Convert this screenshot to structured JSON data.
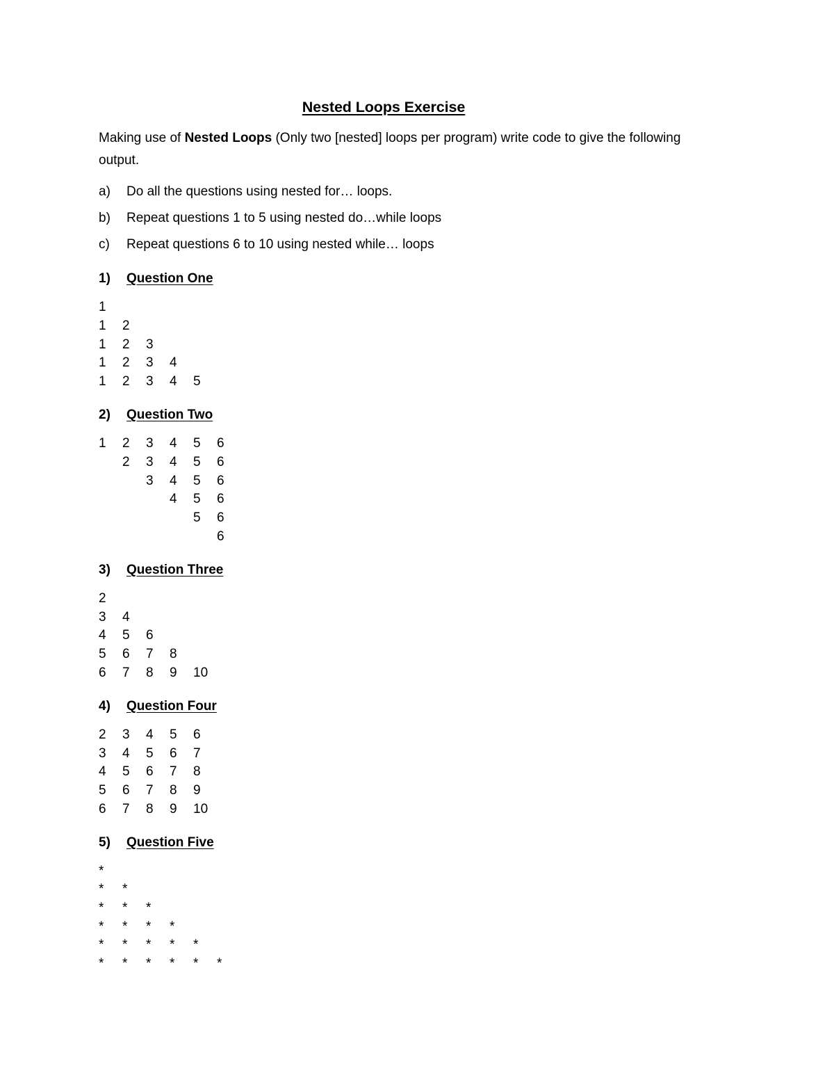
{
  "document": {
    "title": "Nested Loops Exercise",
    "intro": {
      "before_bold": "Making use of ",
      "bold": "Nested Loops",
      "after_bold": " (Only two [nested] loops per program) write code to give the following output."
    },
    "instructions": [
      {
        "marker": "a)",
        "text": "Do all the questions using nested for… loops."
      },
      {
        "marker": "b)",
        "text": "Repeat questions 1 to 5 using nested do…while loops"
      },
      {
        "marker": "c)",
        "text": "Repeat questions 6 to 10 using nested while… loops"
      }
    ],
    "questions": [
      {
        "number": "1)",
        "label": "Question One",
        "pattern_type": "numbers",
        "rows": [
          [
            "1"
          ],
          [
            "1",
            "2"
          ],
          [
            "1",
            "2",
            "3"
          ],
          [
            "1",
            "2",
            "3",
            "4"
          ],
          [
            "1",
            "2",
            "3",
            "4",
            "5"
          ]
        ]
      },
      {
        "number": "2)",
        "label": "Question Two",
        "pattern_type": "numbers",
        "rows": [
          [
            "1",
            "2",
            "3",
            "4",
            "5",
            "6"
          ],
          [
            "",
            "2",
            "3",
            "4",
            "5",
            "6"
          ],
          [
            "",
            "",
            "3",
            "4",
            "5",
            "6"
          ],
          [
            "",
            "",
            "",
            "4",
            "5",
            "6"
          ],
          [
            "",
            "",
            "",
            "",
            "5",
            "6"
          ],
          [
            "",
            "",
            "",
            "",
            "",
            "6"
          ]
        ]
      },
      {
        "number": "3)",
        "label": "Question Three",
        "pattern_type": "numbers",
        "rows": [
          [
            "2"
          ],
          [
            "3",
            "4"
          ],
          [
            "4",
            "5",
            "6"
          ],
          [
            "5",
            "6",
            "7",
            "8"
          ],
          [
            "6",
            "7",
            "8",
            "9",
            "10"
          ]
        ]
      },
      {
        "number": "4)",
        "label": "Question Four",
        "pattern_type": "numbers",
        "rows": [
          [
            "2",
            "3",
            "4",
            "5",
            "6"
          ],
          [
            "3",
            "4",
            "5",
            "6",
            "7"
          ],
          [
            "4",
            "5",
            "6",
            "7",
            "8"
          ],
          [
            "5",
            "6",
            "7",
            "8",
            "9"
          ],
          [
            "6",
            "7",
            "8",
            "9",
            "10"
          ]
        ]
      },
      {
        "number": "5)",
        "label": "Question Five",
        "pattern_type": "stars",
        "rows": [
          [
            "*"
          ],
          [
            "*",
            "*"
          ],
          [
            "*",
            "*",
            "*"
          ],
          [
            "*",
            "*",
            "*",
            "*"
          ],
          [
            "*",
            "*",
            "*",
            "*",
            "*"
          ],
          [
            "*",
            "*",
            "*",
            "*",
            "*",
            "*"
          ]
        ]
      }
    ]
  }
}
